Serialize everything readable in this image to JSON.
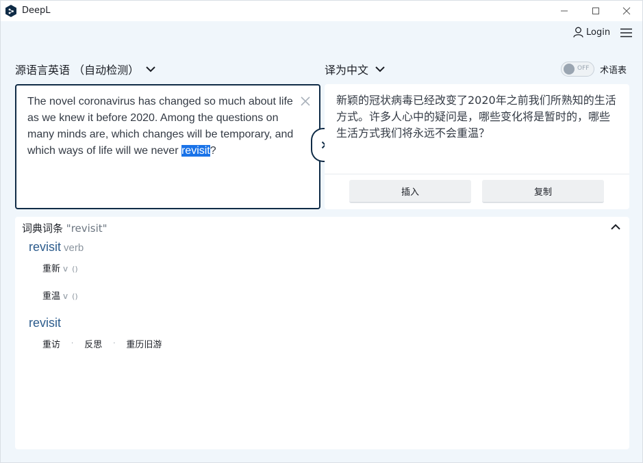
{
  "app": {
    "title": "DeepL"
  },
  "header": {
    "login_label": "Login"
  },
  "source": {
    "language_label": "源语言英语 （自动检测）",
    "text_before": "The novel coronavirus has changed so much about life as we knew it before 2020. Among the questions on many minds are, which changes will be temporary, and which ways of life will we never ",
    "text_selected": "revisit",
    "text_after": "?"
  },
  "target": {
    "language_label": "译为中文",
    "text": "新颖的冠状病毒已经改变了2020年之前我们所熟知的生活方式。许多人心中的疑问是，哪些变化将是暂时的，哪些生活方式我们将永远不会重温？",
    "insert_label": "插入",
    "copy_label": "复制"
  },
  "glossary": {
    "toggle_state": "OFF",
    "label": "术语表"
  },
  "dictionary": {
    "heading": "词典词条",
    "query": "\"revisit\"",
    "entries": [
      {
        "word": "revisit",
        "pos": "verb",
        "senses": [
          {
            "text": "重新",
            "pos": "v",
            "paren": "()"
          },
          {
            "text": "重温",
            "pos": "v",
            "paren": "()"
          }
        ]
      },
      {
        "word": "revisit",
        "alternatives": [
          "重访",
          "反思",
          "重历旧游"
        ],
        "separator": "·"
      }
    ]
  },
  "colors": {
    "accent_dark": "#0f2b46",
    "selection": "#1a73e8",
    "dict_word": "#2b5b8c",
    "background": "#f0f6fb"
  }
}
